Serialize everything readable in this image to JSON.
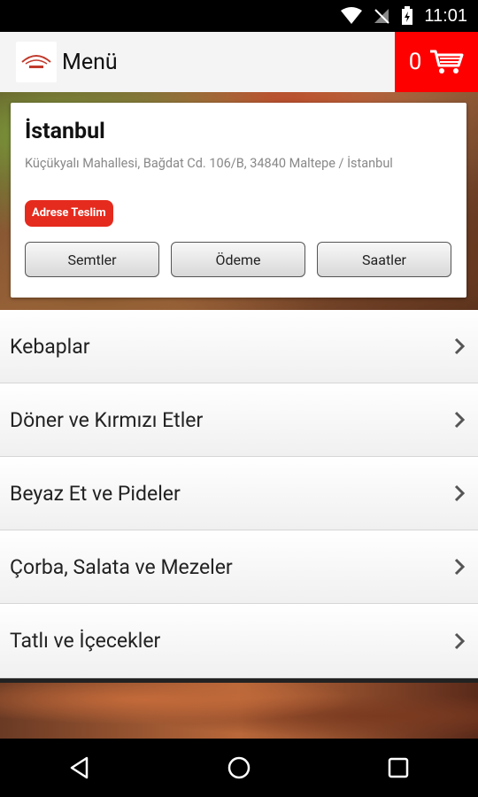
{
  "status": {
    "time": "11:01"
  },
  "header": {
    "title": "Menü",
    "cart_count": "0"
  },
  "card": {
    "city": "İstanbul",
    "address": "Küçükyalı Mahallesi, Bağdat Cd. 106/B, 34840 Maltepe / İstanbul",
    "badge": "Adrese Teslim",
    "buttons": [
      "Semtler",
      "Ödeme",
      "Saatler"
    ]
  },
  "menu": {
    "items": [
      {
        "label": "Kebaplar"
      },
      {
        "label": "Döner ve Kırmızı Etler"
      },
      {
        "label": "Beyaz Et ve Pideler"
      },
      {
        "label": "Çorba, Salata ve Mezeler"
      },
      {
        "label": "Tatlı ve İçecekler"
      }
    ]
  },
  "colors": {
    "accent": "#ff0000",
    "badge": "#e52b1e"
  }
}
